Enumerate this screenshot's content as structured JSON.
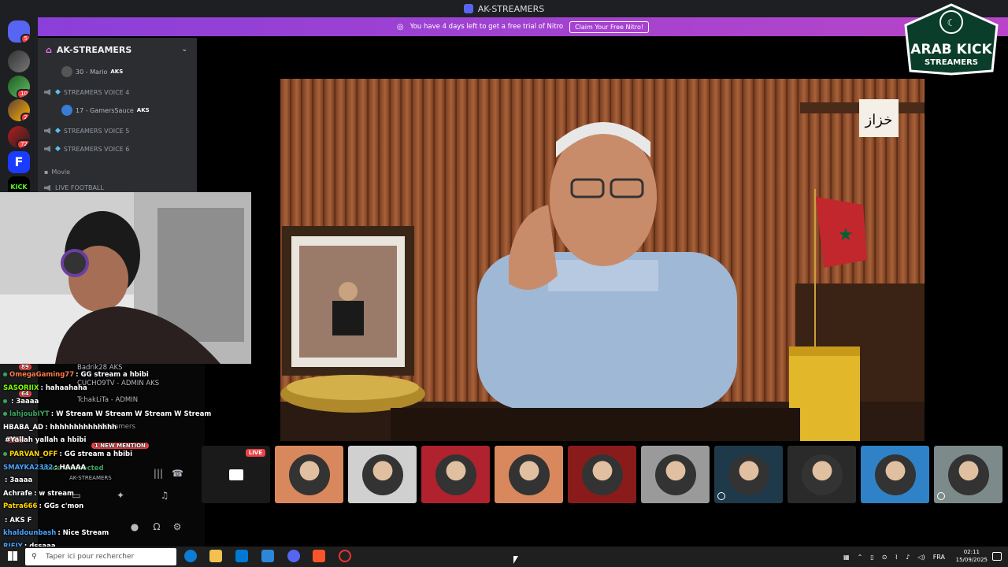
{
  "window": {
    "title": "AK-STREAMERS"
  },
  "nitro": {
    "message": "You have 4 days left to get a free trial of Nitro",
    "button": "Claim Your Free Nitro!"
  },
  "rail": {
    "discord_badge": "5",
    "servers": [
      {
        "name": "server-1",
        "badge": ""
      },
      {
        "name": "server-2",
        "badge": "10"
      },
      {
        "name": "server-3",
        "badge": "2"
      },
      {
        "name": "server-4",
        "badge": "72"
      },
      {
        "name": "server-5",
        "badge": ""
      },
      {
        "name": "kick",
        "label": "KICK",
        "badge": ""
      }
    ]
  },
  "guild": {
    "name": "AK-STREAMERS",
    "channels": [
      {
        "kind": "member",
        "name": "30 - Mario",
        "tag": "AKS"
      },
      {
        "kind": "voice",
        "name": "STREAMERS VOICE 4"
      },
      {
        "kind": "member",
        "name": "17 - GamersSauce",
        "tag": "AKS"
      },
      {
        "kind": "voice",
        "name": "STREAMERS VOICE 5"
      },
      {
        "kind": "voice",
        "name": "STREAMERS VOICE 6"
      },
      {
        "kind": "category",
        "name": "Movie"
      },
      {
        "kind": "voice",
        "name": "LIVE FOOTBALL"
      }
    ]
  },
  "chat": {
    "lines": [
      {
        "user": "OmegaGaming77",
        "color": "#ff7a45",
        "text": ": GG stream a hbibi",
        "dot": true
      },
      {
        "user": "SASORIIX",
        "color": "#7cfc00",
        "text": ": hahaahaha",
        "dot": false
      },
      {
        "user": "",
        "color": "#ff4d4d",
        "text": ": 3aaaa",
        "dot": true
      },
      {
        "user": "lahjoubIYT",
        "color": "#3ba55d",
        "text": ": W Stream W Stream W Stream W Stream",
        "dot": true
      },
      {
        "user": "HBABA_AD",
        "color": "#ffffff",
        "text": ": hhhhhhhhhhhhhh",
        "dot": false
      },
      {
        "user": "",
        "color": "#ff4d4d",
        "text": "#Yallah yallah a hbibi",
        "dot": false
      },
      {
        "user": "PARVAN_OFF",
        "color": "#ffd700",
        "text": ": GG stream a hbibi",
        "dot": true
      },
      {
        "user": "SMAYKA2332",
        "color": "#4aa3ff",
        "text": ": HAAAA",
        "dot": false
      },
      {
        "user": "",
        "color": "#ff4d4d",
        "text": ": 3aaaa",
        "dot": false
      },
      {
        "user": "Achrafe",
        "color": "#ffffff",
        "text": ": w stream",
        "dot": false
      },
      {
        "user": "Patra666",
        "color": "#ffd700",
        "text": ": GGs c'mon",
        "dot": false
      },
      {
        "user": "",
        "color": "#ff4d4d",
        "text": ": AKS F",
        "dot": false
      },
      {
        "user": "khaldounbash",
        "color": "#4aa3ff",
        "text": ": Nice Stream",
        "dot": false
      },
      {
        "user": "RIFIY",
        "color": "#4aa3ff",
        "text": ": dssaaa",
        "dot": false
      }
    ],
    "underlay": {
      "members": [
        "Badrik28",
        "CUCHO9TV - ADMIN",
        "TchakLiTa - ADMIN"
      ],
      "member_tag": "AKS",
      "category": "Streamers",
      "mention": "1 NEW MENTION",
      "voice_status": "Voice Connected",
      "voice_channel": "AK-STREAMERS"
    },
    "badges": {
      "a": "89",
      "b": "64",
      "new": "NEW"
    }
  },
  "stage": {
    "live_label": "LIVE",
    "watermark": "خزاز",
    "tiles": [
      {
        "name": "screen-share",
        "bg": "#1a1a1a",
        "live": true,
        "muted": false
      },
      {
        "name": "participant-1",
        "bg": "#d9885e",
        "live": false,
        "muted": false
      },
      {
        "name": "participant-2",
        "bg": "#d0d0d0",
        "live": false,
        "muted": false
      },
      {
        "name": "participant-3",
        "bg": "#b0222e",
        "live": false,
        "muted": false
      },
      {
        "name": "participant-4",
        "bg": "#d9885e",
        "live": false,
        "muted": false
      },
      {
        "name": "participant-5",
        "bg": "#8a1b1b",
        "live": false,
        "muted": false
      },
      {
        "name": "participant-6",
        "bg": "#9a9a9a",
        "live": false,
        "muted": false
      },
      {
        "name": "participant-7",
        "bg": "#1e3a4a",
        "live": false,
        "muted": true
      },
      {
        "name": "participant-8",
        "bg": "#2a2a2a",
        "live": false,
        "muted": false
      },
      {
        "name": "participant-9",
        "bg": "#2f82c7",
        "live": false,
        "muted": false
      },
      {
        "name": "participant-10",
        "bg": "#7d8a8a",
        "live": false,
        "muted": true
      }
    ]
  },
  "logo": {
    "line1": "ARAB KICK",
    "line2": "STREAMERS"
  },
  "taskbar": {
    "search_placeholder": "Taper ici pour rechercher",
    "language": "FRA",
    "time": "02:11",
    "date": "15/09/2025"
  },
  "colors": {
    "discord": "#5865f2",
    "nitro_start": "#8b3fd9",
    "nitro_end": "#b845c8",
    "live": "#ed4245"
  }
}
